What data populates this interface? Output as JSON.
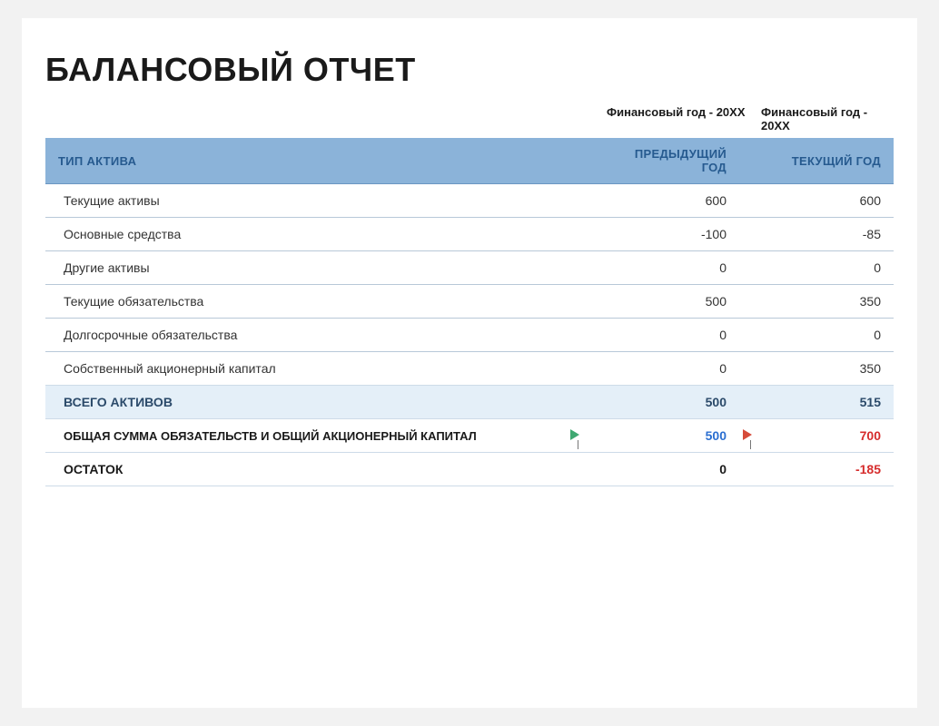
{
  "title": "БАЛАНСОВЫЙ ОТЧЕТ",
  "year_labels": {
    "prev": "Финансовый год - 20XX",
    "curr": "Финансовый год - 20XX"
  },
  "headers": {
    "asset_type": "ТИП АКТИВА",
    "prev_year": "ПРЕДЫДУЩИЙ ГОД",
    "curr_year": "ТЕКУЩИЙ ГОД"
  },
  "rows": [
    {
      "label": "Текущие активы",
      "prev": "600",
      "curr": "600",
      "prev_neg": false,
      "curr_neg": false
    },
    {
      "label": "Основные средства",
      "prev": "-100",
      "curr": "-85",
      "prev_neg": true,
      "curr_neg": true
    },
    {
      "label": "Другие активы",
      "prev": "0",
      "curr": "0",
      "prev_neg": false,
      "curr_neg": false
    },
    {
      "label": "Текущие обязательства",
      "prev": "500",
      "curr": "350",
      "prev_neg": false,
      "curr_neg": false
    },
    {
      "label": "Долгосрочные обязательства",
      "prev": "0",
      "curr": "0",
      "prev_neg": false,
      "curr_neg": false
    },
    {
      "label": "Собственный акционерный капитал",
      "prev": "0",
      "curr": "350",
      "prev_neg": false,
      "curr_neg": false
    }
  ],
  "summary": {
    "total_assets": {
      "label": "ВСЕГО АКТИВОВ",
      "prev": "500",
      "curr": "515"
    },
    "total_liab": {
      "label": "ОБЩАЯ СУММА ОБЯЗАТЕЛЬСТВ И ОБЩИЙ АКЦИОНЕРНЫЙ КАПИТАЛ",
      "prev": "500",
      "curr": "700"
    },
    "balance": {
      "label": "ОСТАТОК",
      "prev": "0",
      "curr": "-185"
    }
  },
  "icons": {
    "flag_prev": "green-flag",
    "flag_curr": "red-flag"
  }
}
